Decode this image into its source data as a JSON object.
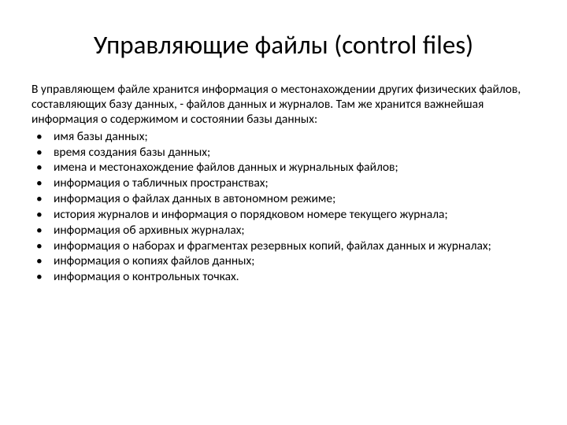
{
  "title": "Управляющие файлы (control files)",
  "intro": "В управляющем файле хранится информация о местонахождении  других физических файлов, составляющих базу данных, - файлов  данных и журналов. Там же хранится важнейшая информация о содержимом и состоянии базы данных:",
  "bullets": [
    "имя базы данных;",
    "время создания базы данных;",
    "имена и местонахождение файлов данных и журнальных файлов;",
    "информация о табличных пространствах;",
    "информация о файлах данных в автономном режиме;",
    "история журналов и информация о порядковом номере текущего журнала;",
    "информация об архивных журналах;",
    "информация о наборах и фрагментах резервных копий, файлах данных и журналах;",
    "информация о копиях файлов данных;",
    "информация о контрольных точках."
  ]
}
